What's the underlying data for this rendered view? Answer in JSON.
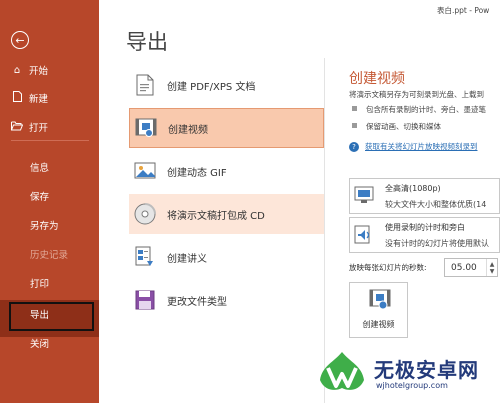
{
  "titlebar": {
    "filename": "表白.ppt  -  Pow"
  },
  "sidebar": {
    "back_icon": "back-arrow-icon",
    "items": [
      {
        "label": "开始",
        "icon": "home-icon"
      },
      {
        "label": "新建",
        "icon": "new-file-icon"
      },
      {
        "label": "打开",
        "icon": "open-folder-icon"
      },
      {
        "label": "信息"
      },
      {
        "label": "保存"
      },
      {
        "label": "另存为"
      },
      {
        "label": "历史记录"
      },
      {
        "label": "打印"
      },
      {
        "label": "共享"
      },
      {
        "label": "导出"
      },
      {
        "label": "关闭"
      }
    ],
    "selected": "导出"
  },
  "page": {
    "title": "导出"
  },
  "options": [
    {
      "label": "创建 PDF/XPS 文档",
      "icon": "pdf-document-icon"
    },
    {
      "label": "创建视频",
      "icon": "video-icon"
    },
    {
      "label": "创建动态 GIF",
      "icon": "gif-icon"
    },
    {
      "label": "将演示文稿打包成 CD",
      "icon": "cd-icon"
    },
    {
      "label": "创建讲义",
      "icon": "handout-icon"
    },
    {
      "label": "更改文件类型",
      "icon": "change-file-type-icon"
    }
  ],
  "selected_option": "创建视频",
  "detail": {
    "heading": "创建视频",
    "description": "将演示文稿另存为可刻录到光盘、上载到",
    "bullets": [
      "包含所有录制的计时、旁白、墨迹笔",
      "保留动画、切换和媒体"
    ],
    "link": "获取有关将幻灯片放映视频刻录到",
    "quality": {
      "title": "全高清(1080p)",
      "subtitle": "较大文件大小和整体优质(14"
    },
    "timing": {
      "title": "使用录制的计时和旁白",
      "subtitle": "没有计时的幻灯片将使用默认"
    },
    "seconds_label": "放映每张幻灯片的秒数:",
    "seconds_value": "05.00",
    "create_button": "创建视频"
  },
  "watermark": {
    "text": "无极安卓网",
    "url": "wjhotelgroup.com"
  }
}
